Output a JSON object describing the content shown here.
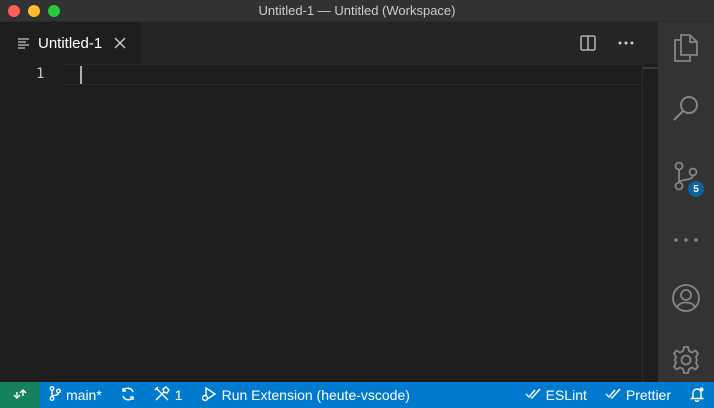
{
  "window": {
    "title": "Untitled-1 — Untitled (Workspace)"
  },
  "tabs": [
    {
      "label": "Untitled-1"
    }
  ],
  "editor": {
    "line_numbers": [
      "1"
    ]
  },
  "activity_bar": {
    "items": [
      {
        "icon": "explorer-icon"
      },
      {
        "icon": "search-icon"
      },
      {
        "icon": "source-control-icon",
        "badge": "5"
      },
      {
        "icon": "more-icon"
      },
      {
        "icon": "account-icon"
      },
      {
        "icon": "gear-icon"
      }
    ]
  },
  "status_bar": {
    "branch": "main*",
    "problems_count": "1",
    "run_extension": "Run Extension (heute-vscode)",
    "eslint": "ESLint",
    "prettier": "Prettier"
  },
  "colors": {
    "status_bar": "#007acc",
    "remote": "#16825d",
    "badge": "#0e639c",
    "activity_bar": "#333333",
    "editor_bg": "#1e1e1e"
  }
}
